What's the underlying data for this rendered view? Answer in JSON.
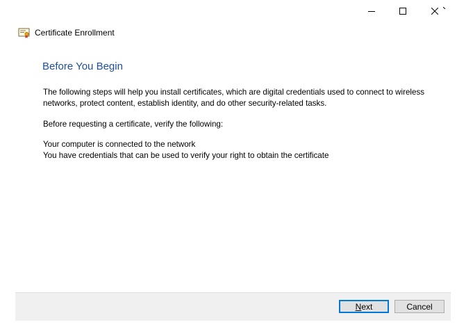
{
  "window": {
    "title": "Certificate Enrollment",
    "controls": {
      "minimize_icon": "minimize-icon",
      "maximize_icon": "maximize-icon",
      "close_icon": "close-icon"
    }
  },
  "page": {
    "heading": "Before You Begin",
    "intro": "The following steps will help you install certificates, which are digital credentials used to connect to wireless networks, protect content, establish identity, and do other security-related tasks.",
    "verify_prompt": "Before requesting a certificate, verify the following:",
    "requirements": [
      "Your computer is connected to the network",
      "You have credentials that can be used to verify your right to obtain the certificate"
    ]
  },
  "footer": {
    "next_accel": "N",
    "next_rest": "ext",
    "cancel_label": "Cancel"
  },
  "colors": {
    "heading": "#1f4e9b",
    "default_button_border": "#0078d7",
    "footer_bg": "#f0f0f0",
    "button_bg": "#e1e1e1"
  }
}
